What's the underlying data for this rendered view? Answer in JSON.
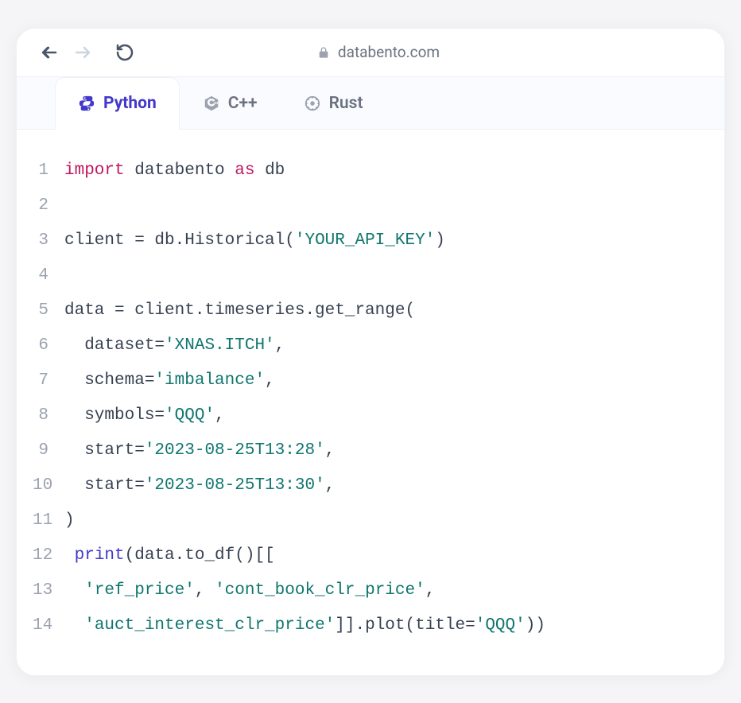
{
  "browser": {
    "url": "databento.com"
  },
  "tabs": [
    {
      "label": "Python",
      "active": true
    },
    {
      "label": "C++",
      "active": false
    },
    {
      "label": "Rust",
      "active": false
    }
  ],
  "code": {
    "lines": [
      {
        "num": "1",
        "tokens": [
          {
            "t": "import",
            "c": "tk-keyword-import"
          },
          {
            "t": " databento ",
            "c": "tk-default"
          },
          {
            "t": "as",
            "c": "tk-keyword-as"
          },
          {
            "t": " db",
            "c": "tk-default"
          }
        ]
      },
      {
        "num": "2",
        "tokens": []
      },
      {
        "num": "3",
        "tokens": [
          {
            "t": "client = db.Historical(",
            "c": "tk-default"
          },
          {
            "t": "'YOUR_API_KEY'",
            "c": "tk-string"
          },
          {
            "t": ")",
            "c": "tk-default"
          }
        ]
      },
      {
        "num": "4",
        "tokens": []
      },
      {
        "num": "5",
        "tokens": [
          {
            "t": "data = client.timeseries.get_range(",
            "c": "tk-default"
          }
        ]
      },
      {
        "num": "6",
        "tokens": [
          {
            "t": "  dataset=",
            "c": "tk-default"
          },
          {
            "t": "'XNAS.ITCH'",
            "c": "tk-string"
          },
          {
            "t": ",",
            "c": "tk-default"
          }
        ]
      },
      {
        "num": "7",
        "tokens": [
          {
            "t": "  schema=",
            "c": "tk-default"
          },
          {
            "t": "'imbalance'",
            "c": "tk-string"
          },
          {
            "t": ",",
            "c": "tk-default"
          }
        ]
      },
      {
        "num": "8",
        "tokens": [
          {
            "t": "  symbols=",
            "c": "tk-default"
          },
          {
            "t": "'QQQ'",
            "c": "tk-string"
          },
          {
            "t": ",",
            "c": "tk-default"
          }
        ]
      },
      {
        "num": "9",
        "tokens": [
          {
            "t": "  start=",
            "c": "tk-default"
          },
          {
            "t": "'2023-08-25T13:28'",
            "c": "tk-string"
          },
          {
            "t": ",",
            "c": "tk-default"
          }
        ]
      },
      {
        "num": "10",
        "tokens": [
          {
            "t": "  start=",
            "c": "tk-default"
          },
          {
            "t": "'2023-08-25T13:30'",
            "c": "tk-string"
          },
          {
            "t": ",",
            "c": "tk-default"
          }
        ]
      },
      {
        "num": "11",
        "tokens": [
          {
            "t": ")",
            "c": "tk-default"
          }
        ]
      },
      {
        "num": "12",
        "tokens": [
          {
            "t": " ",
            "c": "tk-default"
          },
          {
            "t": "print",
            "c": "tk-builtin"
          },
          {
            "t": "(data.to_df()[[",
            "c": "tk-default"
          }
        ]
      },
      {
        "num": "13",
        "tokens": [
          {
            "t": "  ",
            "c": "tk-default"
          },
          {
            "t": "'ref_price'",
            "c": "tk-string"
          },
          {
            "t": ", ",
            "c": "tk-default"
          },
          {
            "t": "'cont_book_clr_price'",
            "c": "tk-string"
          },
          {
            "t": ",",
            "c": "tk-default"
          }
        ]
      },
      {
        "num": "14",
        "tokens": [
          {
            "t": "  ",
            "c": "tk-default"
          },
          {
            "t": "'auct_interest_clr_price'",
            "c": "tk-string"
          },
          {
            "t": "]].plot(title=",
            "c": "tk-default"
          },
          {
            "t": "'QQQ'",
            "c": "tk-string"
          },
          {
            "t": "))",
            "c": "tk-default"
          }
        ]
      }
    ]
  }
}
